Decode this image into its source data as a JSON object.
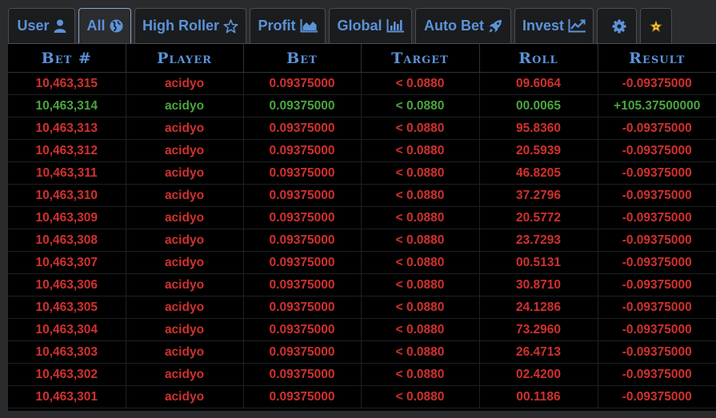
{
  "colors": {
    "accent": "#5b93d9",
    "loss": "#d0312e",
    "win": "#4aa63f",
    "star_badge": "#f4d03f"
  },
  "tabs": [
    {
      "label": "User",
      "icon": "user-icon"
    },
    {
      "label": "All",
      "icon": "globe-icon",
      "active": true
    },
    {
      "label": "High Roller",
      "icon": "star-outline-icon"
    },
    {
      "label": "Profit",
      "icon": "area-chart-icon"
    },
    {
      "label": "Global",
      "icon": "bar-chart-icon"
    },
    {
      "label": "Auto Bet",
      "icon": "rocket-icon"
    },
    {
      "label": "Invest",
      "icon": "line-chart-icon"
    },
    {
      "label": "",
      "icon": "gear-icon"
    },
    {
      "label": "",
      "icon": "star-badge-icon"
    }
  ],
  "table": {
    "headers": [
      "Bet #",
      "Player",
      "Bet",
      "Target",
      "Roll",
      "Result"
    ],
    "rows": [
      {
        "bet_id": "10,463,315",
        "player": "acidyo",
        "bet": "0.09375000",
        "target": "< 0.0880",
        "roll": "09.6064",
        "result": "-0.09375000",
        "win": false
      },
      {
        "bet_id": "10,463,314",
        "player": "acidyo",
        "bet": "0.09375000",
        "target": "< 0.0880",
        "roll": "00.0065",
        "result": "+105.37500000",
        "win": true
      },
      {
        "bet_id": "10,463,313",
        "player": "acidyo",
        "bet": "0.09375000",
        "target": "< 0.0880",
        "roll": "95.8360",
        "result": "-0.09375000",
        "win": false
      },
      {
        "bet_id": "10,463,312",
        "player": "acidyo",
        "bet": "0.09375000",
        "target": "< 0.0880",
        "roll": "20.5939",
        "result": "-0.09375000",
        "win": false
      },
      {
        "bet_id": "10,463,311",
        "player": "acidyo",
        "bet": "0.09375000",
        "target": "< 0.0880",
        "roll": "46.8205",
        "result": "-0.09375000",
        "win": false
      },
      {
        "bet_id": "10,463,310",
        "player": "acidyo",
        "bet": "0.09375000",
        "target": "< 0.0880",
        "roll": "37.2796",
        "result": "-0.09375000",
        "win": false
      },
      {
        "bet_id": "10,463,309",
        "player": "acidyo",
        "bet": "0.09375000",
        "target": "< 0.0880",
        "roll": "20.5772",
        "result": "-0.09375000",
        "win": false
      },
      {
        "bet_id": "10,463,308",
        "player": "acidyo",
        "bet": "0.09375000",
        "target": "< 0.0880",
        "roll": "23.7293",
        "result": "-0.09375000",
        "win": false
      },
      {
        "bet_id": "10,463,307",
        "player": "acidyo",
        "bet": "0.09375000",
        "target": "< 0.0880",
        "roll": "00.5131",
        "result": "-0.09375000",
        "win": false
      },
      {
        "bet_id": "10,463,306",
        "player": "acidyo",
        "bet": "0.09375000",
        "target": "< 0.0880",
        "roll": "30.8710",
        "result": "-0.09375000",
        "win": false
      },
      {
        "bet_id": "10,463,305",
        "player": "acidyo",
        "bet": "0.09375000",
        "target": "< 0.0880",
        "roll": "24.1286",
        "result": "-0.09375000",
        "win": false
      },
      {
        "bet_id": "10,463,304",
        "player": "acidyo",
        "bet": "0.09375000",
        "target": "< 0.0880",
        "roll": "73.2960",
        "result": "-0.09375000",
        "win": false
      },
      {
        "bet_id": "10,463,303",
        "player": "acidyo",
        "bet": "0.09375000",
        "target": "< 0.0880",
        "roll": "26.4713",
        "result": "-0.09375000",
        "win": false
      },
      {
        "bet_id": "10,463,302",
        "player": "acidyo",
        "bet": "0.09375000",
        "target": "< 0.0880",
        "roll": "02.4200",
        "result": "-0.09375000",
        "win": false
      },
      {
        "bet_id": "10,463,301",
        "player": "acidyo",
        "bet": "0.09375000",
        "target": "< 0.0880",
        "roll": "00.1186",
        "result": "-0.09375000",
        "win": false
      }
    ]
  }
}
